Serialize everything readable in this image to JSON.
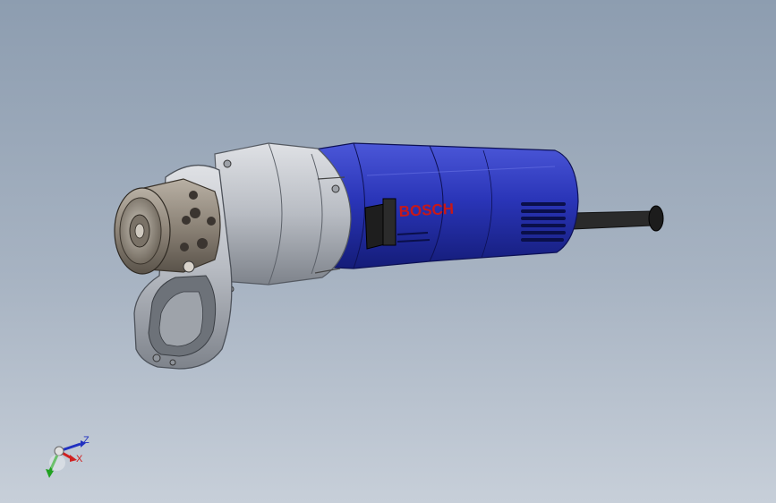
{
  "viewport": {
    "background_top": "#8d9db0",
    "background_bottom": "#c7cfd9"
  },
  "model": {
    "brand_label": "BOSCH",
    "colors": {
      "motor_housing": "#2a35b8",
      "gear_housing": "#b8bcc3",
      "chuck": "#8d8478",
      "handle": "#262626"
    }
  },
  "triad": {
    "z_label": "Z",
    "x_label": "X",
    "colors": {
      "x": "#d02020",
      "y": "#20a020",
      "z": "#2030c0"
    }
  }
}
